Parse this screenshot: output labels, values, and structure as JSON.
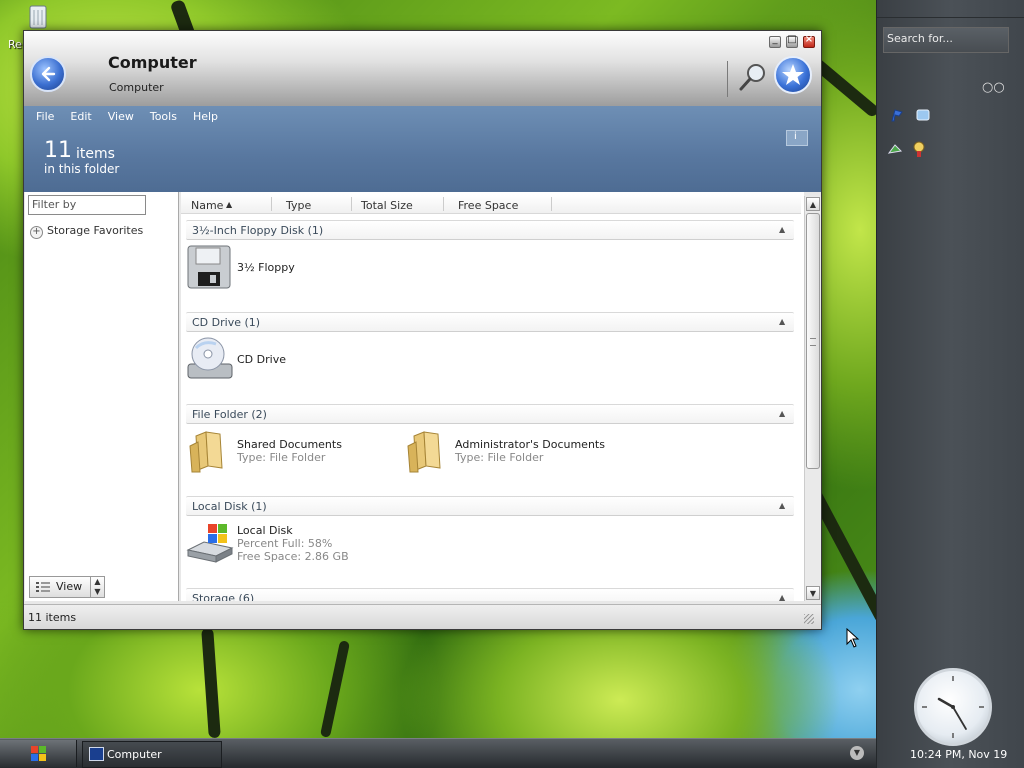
{
  "desktop": {
    "icon_label": "Re"
  },
  "window": {
    "title": "Computer",
    "subtitle": "Computer",
    "menu": [
      "File",
      "Edit",
      "View",
      "Tools",
      "Help"
    ],
    "count_number": "11",
    "count_unit": "items",
    "count_subtitle": "in this folder",
    "info_label": "i",
    "filter_placeholder": "Filter by",
    "storage_favorites": "Storage Favorites",
    "view_button": "View",
    "columns": [
      "Name",
      "Type",
      "Total Size",
      "Free Space"
    ],
    "groups": [
      {
        "header": "3½-Inch Floppy Disk (1)",
        "items": [
          {
            "name": "3½ Floppy",
            "icon": "floppy-icon"
          }
        ]
      },
      {
        "header": "CD Drive (1)",
        "items": [
          {
            "name": "CD Drive",
            "icon": "cd-drive-icon"
          }
        ]
      },
      {
        "header": "File Folder (2)",
        "items": [
          {
            "name": "Shared Documents",
            "sub1": "Type: File Folder",
            "icon": "folder-icon"
          },
          {
            "name": "Administrator's Documents",
            "sub1": "Type: File Folder",
            "icon": "folder-icon"
          }
        ]
      },
      {
        "header": "Local Disk (1)",
        "items": [
          {
            "name": "Local Disk",
            "sub1": "Percent Full: 58%",
            "sub2": "Free Space: 2.86 GB",
            "icon": "local-disk-icon"
          }
        ]
      },
      {
        "header": "Storage (6)",
        "items": []
      }
    ],
    "status": "11 items"
  },
  "sidebar": {
    "search_placeholder": "Search for...",
    "clock_text": "10:24 PM, Nov 19"
  },
  "taskbar": {
    "task_label": "Computer"
  },
  "colors": {
    "menuband": "#58779f",
    "accent_blue": "#3b6fd0",
    "close_red": "#c0281a"
  }
}
